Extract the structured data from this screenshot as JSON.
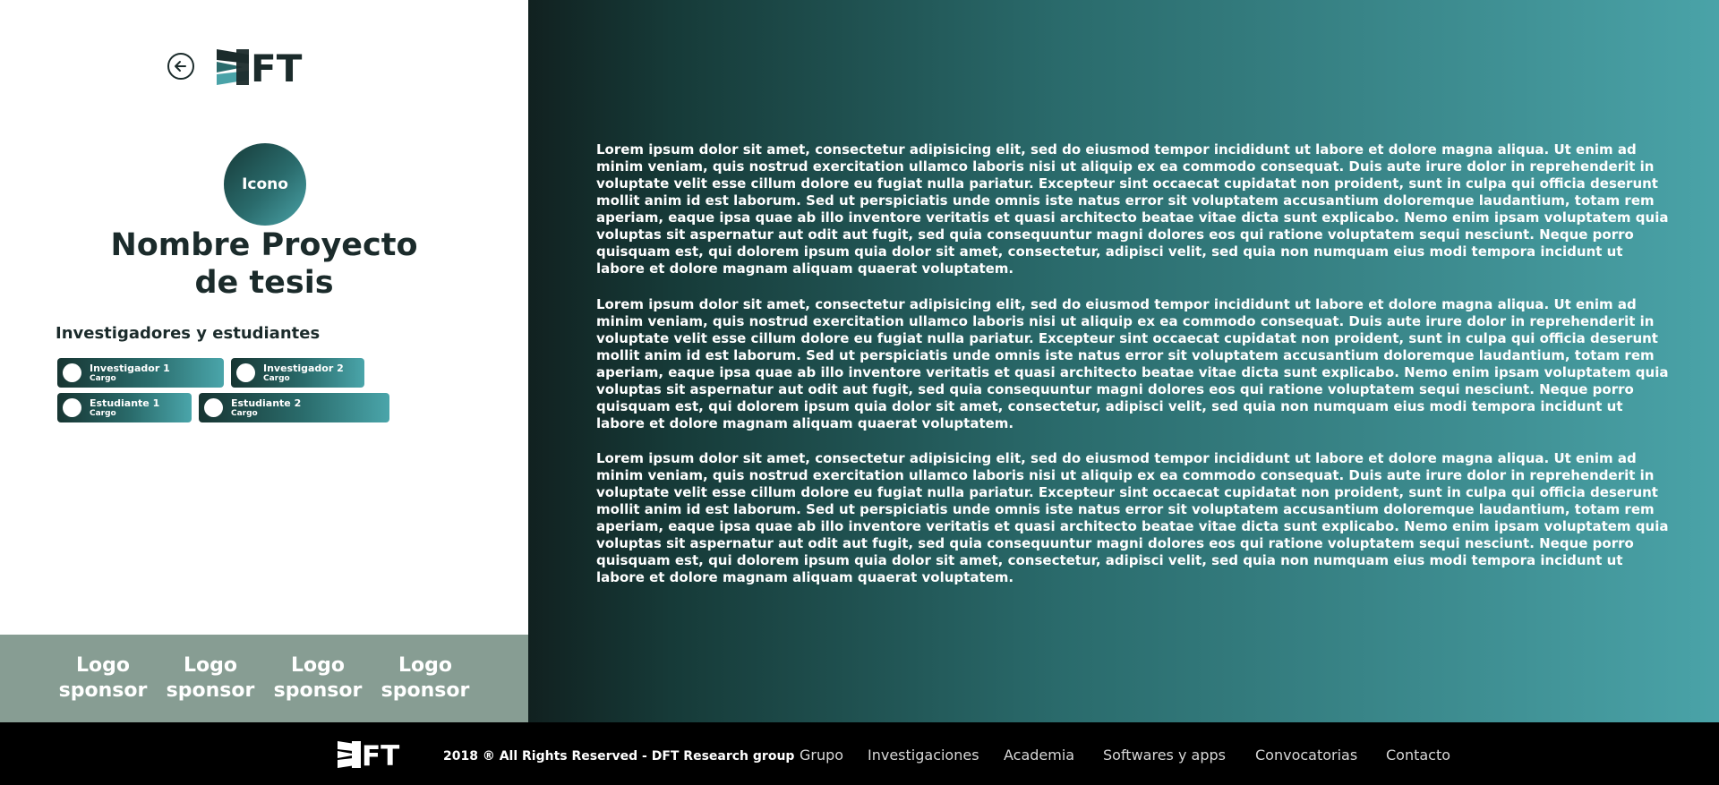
{
  "header": {
    "back_icon": "arrow-left-circle-icon",
    "logo_text": "DFT"
  },
  "project": {
    "icon_label": "Icono",
    "title_line1": "Nombre Proyecto",
    "title_line2": "de tesis"
  },
  "team": {
    "heading": "Investigadores y estudiantes",
    "members": [
      {
        "name": "Investigador 1",
        "role": "Cargo"
      },
      {
        "name": "Investigador 2",
        "role": "Cargo"
      },
      {
        "name": "Estudiante 1",
        "role": "Cargo"
      },
      {
        "name": "Estudiante 2",
        "role": "Cargo"
      }
    ]
  },
  "sponsors": [
    {
      "line1": "Logo",
      "line2": "sponsor"
    },
    {
      "line1": "Logo",
      "line2": "sponsor"
    },
    {
      "line1": "Logo",
      "line2": "sponsor"
    },
    {
      "line1": "Logo",
      "line2": "sponsor"
    }
  ],
  "content": {
    "paragraphs": [
      "Lorem ipsum dolor sit amet, consectetur adipisicing elit, sed do eiusmod tempor incididunt ut labore et dolore magna aliqua. Ut enim ad minim veniam, quis nostrud exercitation ullamco laboris nisi ut aliquip ex ea commodo consequat. Duis aute irure dolor in reprehenderit in voluptate velit esse cillum dolore eu fugiat nulla pariatur. Excepteur sint occaecat cupidatat non proident, sunt in culpa qui officia deserunt mollit anim id est laborum. Sed ut perspiciatis unde omnis iste natus error sit voluptatem accusantium doloremque laudantium, totam rem aperiam, eaque ipsa quae ab illo inventore veritatis et quasi architecto beatae vitae dicta sunt explicabo. Nemo enim ipsam voluptatem quia voluptas sit aspernatur aut odit aut fugit, sed quia consequuntur magni dolores eos qui ratione voluptatem sequi nesciunt. Neque porro quisquam est, qui dolorem ipsum quia dolor sit amet, consectetur, adipisci velit, sed quia non numquam eius modi tempora incidunt ut labore et dolore magnam aliquam quaerat voluptatem.",
      "Lorem ipsum dolor sit amet, consectetur adipisicing elit, sed do eiusmod tempor incididunt ut labore et dolore magna aliqua. Ut enim ad minim veniam, quis nostrud exercitation ullamco laboris nisi ut aliquip ex ea commodo consequat. Duis aute irure dolor in reprehenderit in voluptate velit esse cillum dolore eu fugiat nulla pariatur. Excepteur sint occaecat cupidatat non proident, sunt in culpa qui officia deserunt mollit anim id est laborum. Sed ut perspiciatis unde omnis iste natus error sit voluptatem accusantium doloremque laudantium, totam rem aperiam, eaque ipsa quae ab illo inventore veritatis et quasi architecto beatae vitae dicta sunt explicabo. Nemo enim ipsam voluptatem quia voluptas sit aspernatur aut odit aut fugit, sed quia consequuntur magni dolores eos qui ratione voluptatem sequi nesciunt. Neque porro quisquam est, qui dolorem ipsum quia dolor sit amet, consectetur, adipisci velit, sed quia non numquam eius modi tempora incidunt ut labore et dolore magnam aliquam quaerat voluptatem.",
      "Lorem ipsum dolor sit amet, consectetur adipisicing elit, sed do eiusmod tempor incididunt ut labore et dolore magna aliqua. Ut enim ad minim veniam, quis nostrud exercitation ullamco laboris nisi ut aliquip ex ea commodo consequat. Duis aute irure dolor in reprehenderit in voluptate velit esse cillum dolore eu fugiat nulla pariatur. Excepteur sint occaecat cupidatat non proident, sunt in culpa qui officia deserunt mollit anim id est laborum. Sed ut perspiciatis unde omnis iste natus error sit voluptatem accusantium doloremque laudantium, totam rem aperiam, eaque ipsa quae ab illo inventore veritatis et quasi architecto beatae vitae dicta sunt explicabo. Nemo enim ipsam voluptatem quia voluptas sit aspernatur aut odit aut fugit, sed quia consequuntur magni dolores eos qui ratione voluptatem sequi nesciunt. Neque porro quisquam est, qui dolorem ipsum quia dolor sit amet, consectetur, adipisci velit, sed quia non numquam eius modi tempora incidunt ut labore et dolore magnam aliquam quaerat voluptatem."
    ]
  },
  "footer": {
    "logo_text": "DFT",
    "copyright": "2018 ® All Rights Reserved - DFT Research group",
    "nav": [
      "Grupo",
      "Investigaciones",
      "Academia",
      "Softwares y apps",
      "Convocatorias",
      "Contacto"
    ]
  },
  "colors": {
    "dark_teal": "#163a38",
    "mid_teal": "#2a6b6c",
    "light_teal": "#4aa3a8",
    "sponsor_bg": "#879d93",
    "text_dark": "#1b2b2b",
    "footer_bg": "#000000"
  }
}
